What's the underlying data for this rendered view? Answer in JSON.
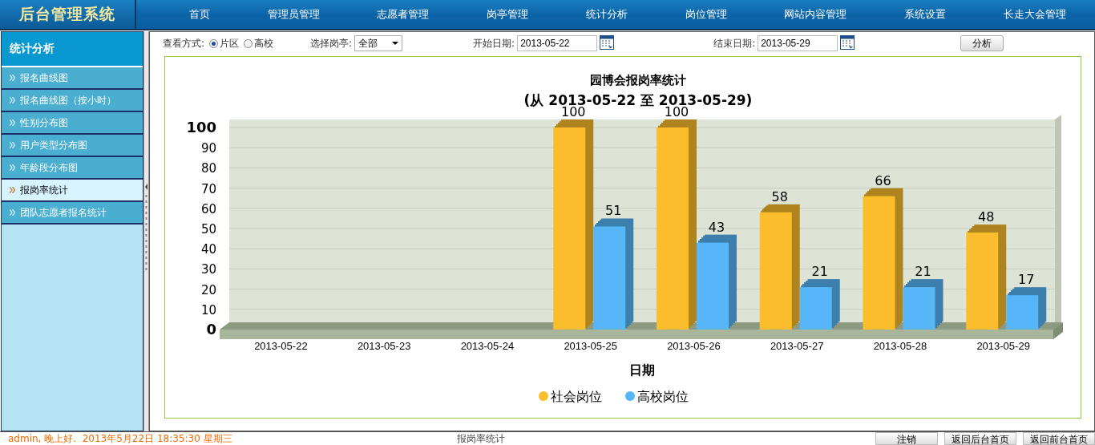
{
  "header": {
    "logo": "后台管理系统",
    "nav": [
      {
        "label": "首页"
      },
      {
        "label": "管理员管理"
      },
      {
        "label": "志愿者管理"
      },
      {
        "label": "岗亭管理"
      },
      {
        "label": "统计分析"
      },
      {
        "label": "岗位管理"
      },
      {
        "label": "网站内容管理"
      },
      {
        "label": "系统设置"
      },
      {
        "label": "长走大会管理"
      }
    ]
  },
  "sidebar": {
    "title": "统计分析",
    "items": [
      {
        "label": "报名曲线图",
        "selected": false
      },
      {
        "label": "报名曲线图（按小时）",
        "selected": false
      },
      {
        "label": "性别分布图",
        "selected": false
      },
      {
        "label": "用户类型分布图",
        "selected": false
      },
      {
        "label": "年龄段分布图",
        "selected": false
      },
      {
        "label": "报岗率统计",
        "selected": true
      },
      {
        "label": "团队志愿者报名统计",
        "selected": false
      }
    ]
  },
  "filters": {
    "view_mode": {
      "label": "查看方式:",
      "options": [
        {
          "label": "片区",
          "selected": true
        },
        {
          "label": "高校",
          "selected": false
        }
      ]
    },
    "booth": {
      "label": "选择岗亭:",
      "value": "全部"
    },
    "start_date": {
      "label": "开始日期:",
      "value": "2013-05-22"
    },
    "end_date": {
      "label": "结束日期:",
      "value": "2013-05-29"
    },
    "button": "分析"
  },
  "chart": {
    "chart_data": {
      "type": "bar",
      "title": "园博会报岗率统计\n(从 2013-05-22 至 2013-05-29)",
      "xlabel": "日期",
      "categories": [
        "2013-05-22",
        "2013-05-23",
        "2013-05-24",
        "2013-05-25",
        "2013-05-26",
        "2013-05-27",
        "2013-05-28",
        "2013-05-29"
      ],
      "series": [
        {
          "name": "社会岗位",
          "color": "#fbbd2c",
          "values": [
            0,
            0,
            0,
            100,
            100,
            58,
            66,
            48
          ],
          "value_labels": [
            null,
            null,
            null,
            "100",
            "100",
            "58",
            "66",
            "48"
          ]
        },
        {
          "name": "高校岗位",
          "color": "#56b6f8",
          "values": [
            0,
            0,
            0,
            51,
            43,
            21,
            21,
            17
          ],
          "value_labels": [
            null,
            null,
            null,
            "51",
            "43",
            "21",
            "21",
            "17"
          ]
        }
      ],
      "ylim": [
        0,
        100
      ],
      "yticks": [
        0,
        10,
        20,
        30,
        40,
        50,
        60,
        70,
        80,
        90,
        100
      ],
      "grid": true,
      "legend": "bottom"
    }
  },
  "status_bar": {
    "greeting": "admin, 晚上好.  2013年5月22日 18:35:30 星期三",
    "page_title": "报岗率统计",
    "buttons": [
      "注销",
      "返回后台首页",
      "返回前台首页"
    ]
  }
}
